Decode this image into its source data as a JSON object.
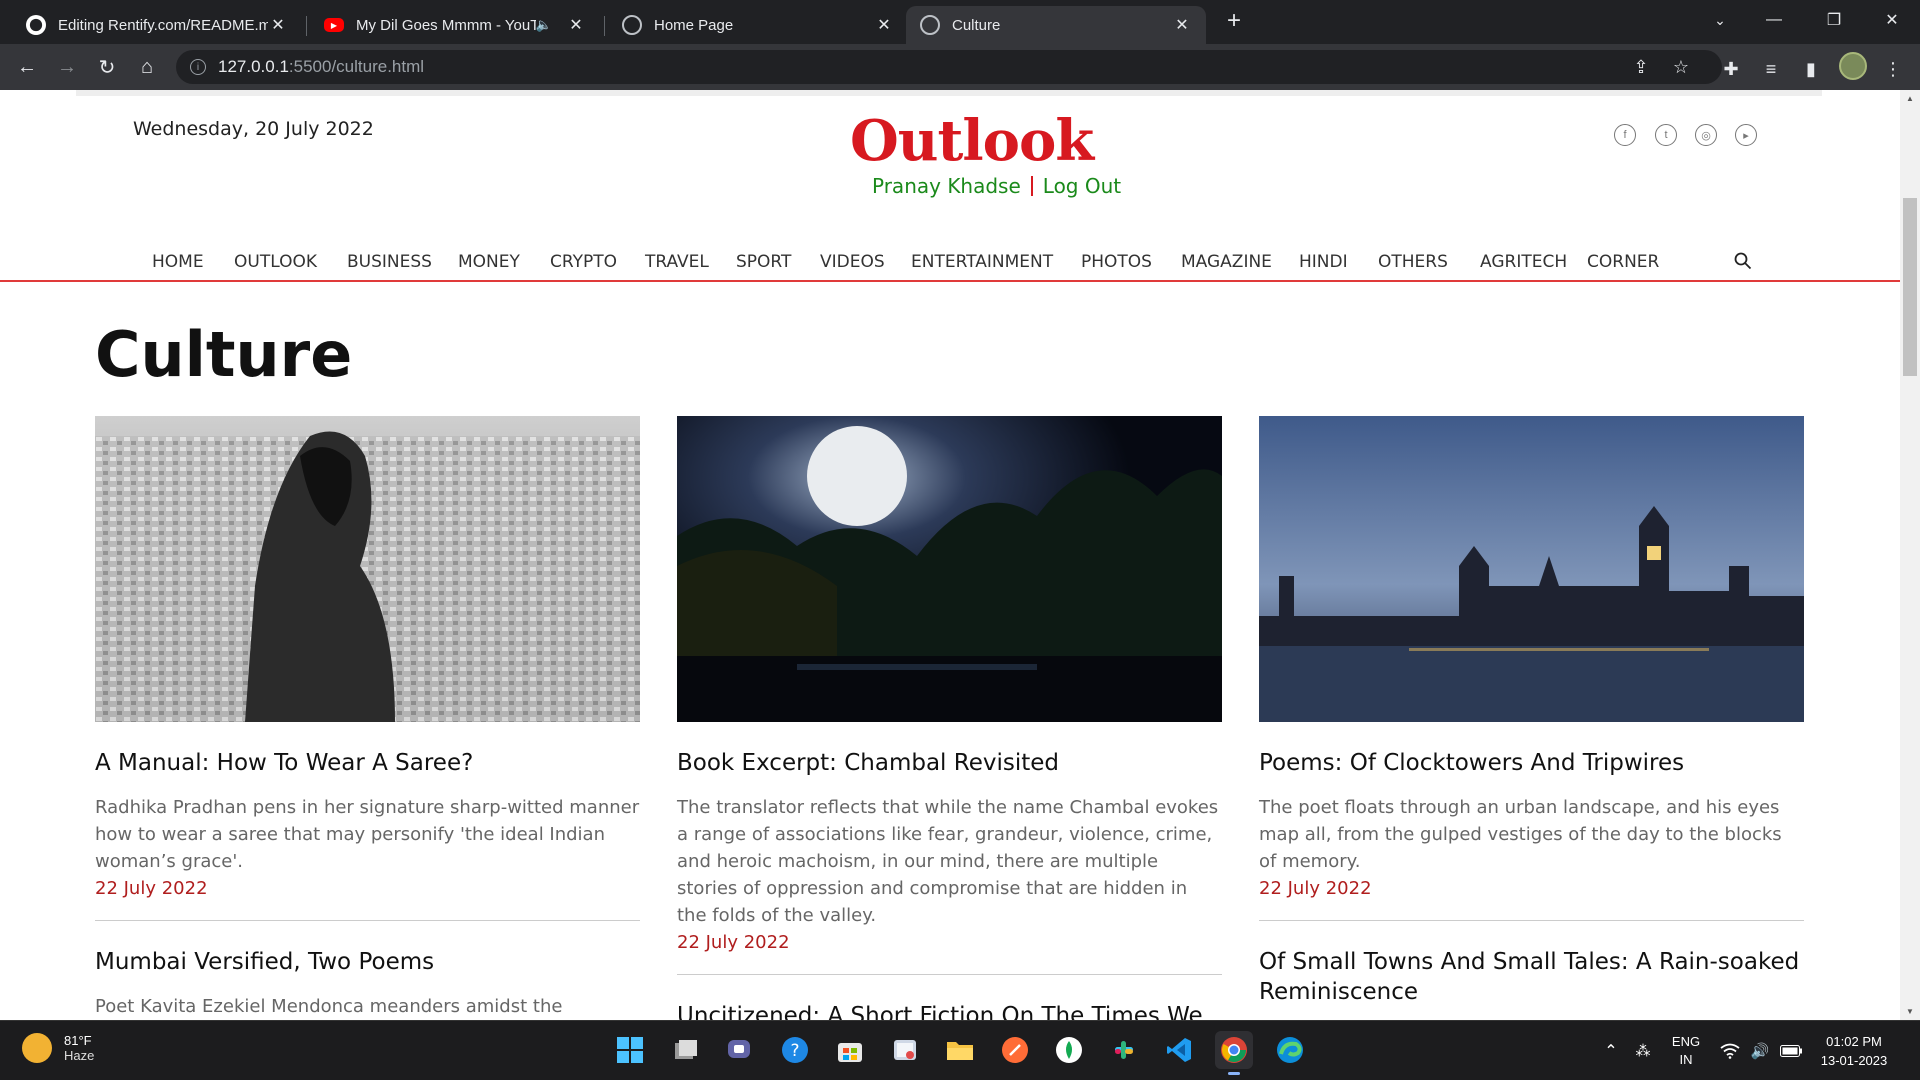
{
  "browser": {
    "tabs": [
      {
        "title": "Editing Rentify.com/README.md"
      },
      {
        "title": "My Dil Goes Mmmm - YouTube"
      },
      {
        "title": "Home Page"
      },
      {
        "title": "Culture"
      }
    ],
    "url_host": "127.0.0.1",
    "url_path": ":5500/culture.html"
  },
  "header": {
    "date": "Wednesday, 20 July 2022",
    "logo": "Outlook",
    "user_name": "Pranay Khadse",
    "logout": "Log Out"
  },
  "nav": [
    "HOME",
    "OUTLOOK",
    "BUSINESS",
    "MONEY",
    "CRYPTO",
    "TRAVEL",
    "SPORT",
    "VIDEOS",
    "ENTERTAINMENT",
    "PHOTOS",
    "MAGAZINE",
    "HINDI",
    "OTHERS",
    "AGRITECH",
    "CORNER"
  ],
  "page_title": "Culture",
  "articles": [
    {
      "title": "A Manual: How To Wear A Saree?",
      "summary": "Radhika Pradhan pens in her signature sharp-witted manner how to wear a saree that may personify 'the ideal Indian woman’s grace'.",
      "date": "22 July 2022"
    },
    {
      "title": "Book Excerpt: Chambal Revisited",
      "summary": "The translator reflects that while the name Chambal evokes a range of associations like fear, grandeur, violence, crime, and heroic machoism, in our mind, there are multiple stories of oppression and compromise that are hidden in the folds of the valley.",
      "date": "22 July 2022"
    },
    {
      "title": "Poems: Of Clocktowers And Tripwires",
      "summary": "The poet floats through an urban landscape, and his eyes map all, from the gulped vestiges of the day to the blocks of memory.",
      "date": "22 July 2022"
    }
  ],
  "next_articles": [
    {
      "title": "Mumbai Versified, Two Poems",
      "summary": "Poet Kavita Ezekiel Mendonca meanders amidst the"
    },
    {
      "title": "Uncitizened: A Short Fiction On The Times We"
    },
    {
      "title": "Of Small Towns And Small Tales: A Rain-soaked Reminiscence"
    }
  ],
  "taskbar": {
    "temp": "81°F",
    "condition": "Haze",
    "lang_top": "ENG",
    "lang_bottom": "IN",
    "time": "01:02 PM",
    "date": "13-01-2023"
  },
  "colors": {
    "brand_red": "#d71920",
    "user_green": "#1b8a1b",
    "date_red": "#b01e1e",
    "nav_underline": "#e03a3a"
  }
}
